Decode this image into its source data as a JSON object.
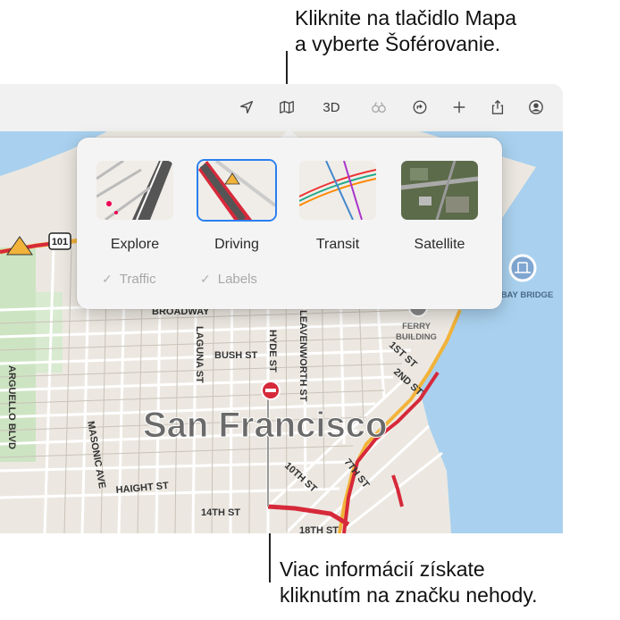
{
  "callouts": {
    "top": [
      "Kliknite na tlačidlo Mapa",
      "a vyberte Šoférovanie."
    ],
    "bottom": [
      "Viac informácií získate",
      "kliknutím na značku nehody."
    ]
  },
  "toolbar": {
    "buttons": [
      {
        "name": "location-arrow-icon",
        "label": ""
      },
      {
        "name": "map-icon",
        "label": ""
      },
      {
        "name": "3d-button",
        "label": "3D"
      },
      {
        "name": "look-around-icon",
        "label": ""
      },
      {
        "name": "directions-icon",
        "label": ""
      },
      {
        "name": "add-icon",
        "label": ""
      },
      {
        "name": "share-icon",
        "label": ""
      },
      {
        "name": "account-icon",
        "label": ""
      }
    ]
  },
  "map_modes": {
    "modes": [
      {
        "label": "Explore",
        "selected": false
      },
      {
        "label": "Driving",
        "selected": true
      },
      {
        "label": "Transit",
        "selected": false
      },
      {
        "label": "Satellite",
        "selected": false
      }
    ],
    "options": [
      {
        "label": "Traffic",
        "checked": true,
        "enabled": false
      },
      {
        "label": "Labels",
        "checked": true,
        "enabled": false
      }
    ]
  },
  "map": {
    "city": "San Francisco",
    "highway_shield": "101",
    "pois": [
      "BAY BRIDGE",
      "FERRY",
      "BUILDING"
    ],
    "streets": [
      "BROADWAY",
      "LAGUNA ST",
      "HYDE ST",
      "LEAVENWORTH ST",
      "BUSH ST",
      "1ST ST",
      "2ND ST",
      "ARGUELLO BLVD",
      "MASONIC AVE",
      "HAIGHT ST",
      "10TH ST",
      "7TH ST",
      "14TH ST",
      "18TH ST"
    ],
    "colors": {
      "land": "#ece8e1",
      "water": "#a9d1ef",
      "park": "#cde4c2",
      "traffic_heavy": "#d6293a",
      "traffic_moderate": "#f2b33a",
      "incident": "#d6293a"
    }
  }
}
